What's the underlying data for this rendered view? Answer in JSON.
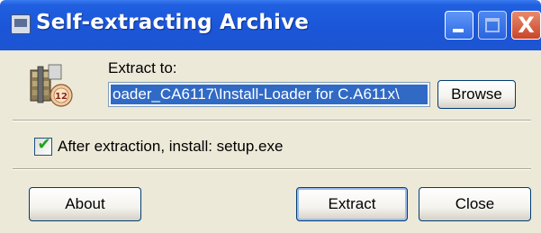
{
  "window": {
    "title": "Self-extracting Archive",
    "icon": "archive-window-icon"
  },
  "title_buttons": {
    "minimize_icon": "minimize-icon",
    "maximize_icon": "maximize-icon",
    "close_glyph": "X"
  },
  "extract": {
    "label": "Extract to:",
    "path_value": "oader_CA6117\\Install-Loader for C.A611x\\",
    "browse_label": "Browse"
  },
  "after_extraction": {
    "checked": true,
    "check_glyph": "✔",
    "label": "After extraction, install: setup.exe"
  },
  "buttons": {
    "about_label": "About",
    "extract_label": "Extract",
    "close_label": "Close"
  },
  "colors": {
    "titlebar": "#1f5fe0",
    "selection": "#316ac5",
    "dialog_bg": "#ece9d8"
  }
}
